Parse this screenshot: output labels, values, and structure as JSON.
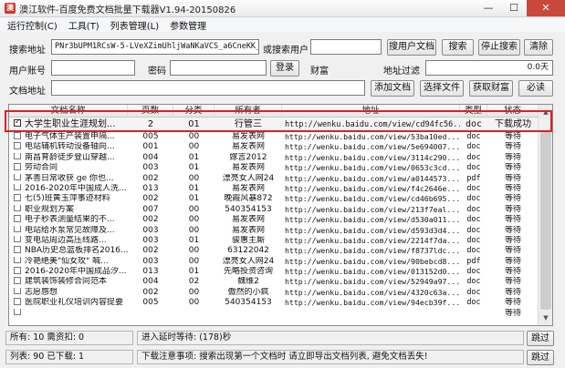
{
  "window": {
    "title": "澳江软件-百度免费文档批量下载器V1.94-20150826",
    "min": "—",
    "max": "☐",
    "close": "✕"
  },
  "menu": [
    "运行控制(C)",
    "工具(T)",
    "列表管理(L)",
    "参数管理"
  ],
  "search": {
    "addr_label": "搜索地址",
    "addr_value": "PNr3bUPM1RCsW-5-LVeXZimUhljWaNKaVCS_a6CneKK_34s1ry",
    "user_label": "或搜索用户",
    "user_value": "",
    "btn_user_docs": "搜用户文档",
    "btn_search": "搜索",
    "btn_stop": "停止搜索",
    "btn_clear": "清除"
  },
  "login": {
    "account_label": "用户账号",
    "account_value": "",
    "password_label": "密码",
    "password_value": "",
    "btn_login": "登录",
    "wealth_label": "财富",
    "filter_label": "地址过滤",
    "filter_value": "0.0天"
  },
  "docaddr": {
    "label": "文档地址",
    "value": "",
    "btn_add": "添加文档",
    "btn_select": "选择文件",
    "btn_get_wealth": "获取财富",
    "btn_must": "必读"
  },
  "table": {
    "headers": [
      "文档名称",
      "页数",
      "分类",
      "所有者",
      "地址",
      "类型",
      "状态"
    ],
    "rows": [
      {
        "name": "大学生职业生涯规划...",
        "pages": "2",
        "cat": "01",
        "owner": "行管三",
        "url": "http://wenku.baidu.com/view/cd94fc56...",
        "type": "doc",
        "status": "下载成功",
        "checked": true
      },
      {
        "name": "电子气体生产装置申隔...",
        "pages": "005",
        "cat": "00",
        "owner": "易发表网",
        "url": "http://wenku.baidu.com/view/53ba10ed...",
        "type": "doc",
        "status": "等待"
      },
      {
        "name": "电站辅机转动设备轴向...",
        "pages": "001",
        "cat": "00",
        "owner": "易发表网",
        "url": "http://wenku.baidu.com/view/5e694007...",
        "type": "doc",
        "status": "等待"
      },
      {
        "name": "南昌育龄徒步登山穿越...",
        "pages": "004",
        "cat": "01",
        "owner": "嫁言2012",
        "url": "http://wenku.baidu.com/view/3114c290...",
        "type": "doc",
        "status": "等待"
      },
      {
        "name": "劳动合同",
        "pages": "003",
        "cat": "01",
        "owner": "易发表网",
        "url": "http://wenku.baidu.com/view/0653c3cd...",
        "type": "doc",
        "status": "等待"
      },
      {
        "name": "茅善日常收获 ge 你也...",
        "pages": "002",
        "cat": "00",
        "owner": "漂亮女人网24",
        "url": "http://wenku.baidu.com/view/a0144573...",
        "type": "pdf",
        "status": "等待"
      },
      {
        "name": "2016-2020年中国成人洗...",
        "pages": "013",
        "cat": "01",
        "owner": "易发表网",
        "url": "http://wenku.baidu.com/view/f4c2646e...",
        "type": "doc",
        "status": "等待"
      },
      {
        "name": "七(5)班黄玉萍事迹材料",
        "pages": "002",
        "cat": "01",
        "owner": "晚霞风暴872",
        "url": "http://wenku.baidu.com/view/cd46b695...",
        "type": "doc",
        "status": "等待"
      },
      {
        "name": "职业规划方案",
        "pages": "007",
        "cat": "00",
        "owner": "540354153",
        "url": "http://wenku.baidu.com/view/213f7eal...",
        "type": "doc",
        "status": "等待"
      },
      {
        "name": "电子秒表测量结果的不...",
        "pages": "002",
        "cat": "00",
        "owner": "易发表网",
        "url": "http://wenku.baidu.com/view/d530a011...",
        "type": "doc",
        "status": "等待"
      },
      {
        "name": "电站给水泵常见故障及...",
        "pages": "003",
        "cat": "00",
        "owner": "易发表网",
        "url": "http://wenku.baidu.com/view/d593d3d4...",
        "type": "doc",
        "status": "等待"
      },
      {
        "name": "变电站周边高压线路...",
        "pages": "003",
        "cat": "01",
        "owner": "骏惠主厮",
        "url": "http://wenku.baidu.com/view/2214f7da...",
        "type": "doc",
        "status": "等待"
      },
      {
        "name": "NBA历史总篮板排名2016...",
        "pages": "002",
        "cat": "00",
        "owner": "63122042",
        "url": "http://wenku.baidu.com/view/f8737ldc...",
        "type": "doc",
        "status": "等待"
      },
      {
        "name": "冷艳绝美\"仙女玫\" 喊...",
        "pages": "003",
        "cat": "00",
        "owner": "漂亮女人网24",
        "url": "http://wenku.baidu.com/view/90bebcd8...",
        "type": "pdf",
        "status": "等待"
      },
      {
        "name": "2016-2020年中国成品汐...",
        "pages": "013",
        "cat": "01",
        "owner": "先略投资咨询",
        "url": "http://wenku.baidu.com/view/013152d0...",
        "type": "doc",
        "status": "等待"
      },
      {
        "name": "建筑装饰装修合同范本",
        "pages": "004",
        "cat": "02",
        "owner": "魏维2",
        "url": "http://wenku.baidu.com/view/52949a97...",
        "type": "doc",
        "status": "等待"
      },
      {
        "name": "志愿感想",
        "pages": "002",
        "cat": "00",
        "owner": "傲然的小疯",
        "url": "http://wenku.baidu.com/view/4320c63a...",
        "type": "doc",
        "status": "等待"
      },
      {
        "name": "医院职业礼仪培训内容提要",
        "pages": "005",
        "cat": "00",
        "owner": "540354153",
        "url": "http://wenku.baidu.com/view/94ecb39f...",
        "type": "doc",
        "status": "等待"
      },
      {
        "name": "",
        "pages": "",
        "cat": "",
        "owner": "",
        "url": "",
        "type": "",
        "status": "等待"
      }
    ]
  },
  "status_bar1": {
    "total": "所有: 10 需资扣: 0",
    "delay": "进入延时等待: (178)秒",
    "skip": "跳过"
  },
  "status_bar2": {
    "list": "列表: 90 已下载: 1",
    "notice_label": "下载注意事项:",
    "notice": "搜索出现第一个文档时 请立即导出文档列表, 避免文档丢失!",
    "skip": "跳过"
  },
  "scroll": {
    "up": "▲",
    "down": "▼"
  }
}
